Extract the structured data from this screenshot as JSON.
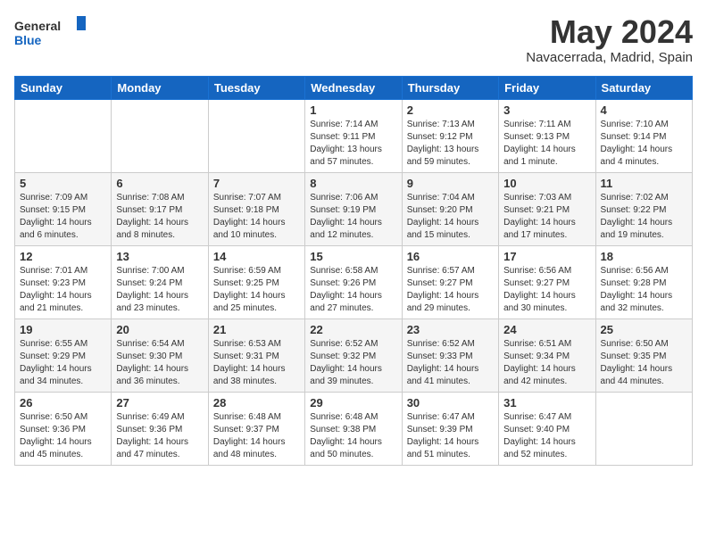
{
  "header": {
    "logo_general": "General",
    "logo_blue": "Blue",
    "month_title": "May 2024",
    "location": "Navacerrada, Madrid, Spain"
  },
  "weekdays": [
    "Sunday",
    "Monday",
    "Tuesday",
    "Wednesday",
    "Thursday",
    "Friday",
    "Saturday"
  ],
  "weeks": [
    [
      {
        "day": "",
        "info": ""
      },
      {
        "day": "",
        "info": ""
      },
      {
        "day": "",
        "info": ""
      },
      {
        "day": "1",
        "info": "Sunrise: 7:14 AM\nSunset: 9:11 PM\nDaylight: 13 hours\nand 57 minutes."
      },
      {
        "day": "2",
        "info": "Sunrise: 7:13 AM\nSunset: 9:12 PM\nDaylight: 13 hours\nand 59 minutes."
      },
      {
        "day": "3",
        "info": "Sunrise: 7:11 AM\nSunset: 9:13 PM\nDaylight: 14 hours\nand 1 minute."
      },
      {
        "day": "4",
        "info": "Sunrise: 7:10 AM\nSunset: 9:14 PM\nDaylight: 14 hours\nand 4 minutes."
      }
    ],
    [
      {
        "day": "5",
        "info": "Sunrise: 7:09 AM\nSunset: 9:15 PM\nDaylight: 14 hours\nand 6 minutes."
      },
      {
        "day": "6",
        "info": "Sunrise: 7:08 AM\nSunset: 9:17 PM\nDaylight: 14 hours\nand 8 minutes."
      },
      {
        "day": "7",
        "info": "Sunrise: 7:07 AM\nSunset: 9:18 PM\nDaylight: 14 hours\nand 10 minutes."
      },
      {
        "day": "8",
        "info": "Sunrise: 7:06 AM\nSunset: 9:19 PM\nDaylight: 14 hours\nand 12 minutes."
      },
      {
        "day": "9",
        "info": "Sunrise: 7:04 AM\nSunset: 9:20 PM\nDaylight: 14 hours\nand 15 minutes."
      },
      {
        "day": "10",
        "info": "Sunrise: 7:03 AM\nSunset: 9:21 PM\nDaylight: 14 hours\nand 17 minutes."
      },
      {
        "day": "11",
        "info": "Sunrise: 7:02 AM\nSunset: 9:22 PM\nDaylight: 14 hours\nand 19 minutes."
      }
    ],
    [
      {
        "day": "12",
        "info": "Sunrise: 7:01 AM\nSunset: 9:23 PM\nDaylight: 14 hours\nand 21 minutes."
      },
      {
        "day": "13",
        "info": "Sunrise: 7:00 AM\nSunset: 9:24 PM\nDaylight: 14 hours\nand 23 minutes."
      },
      {
        "day": "14",
        "info": "Sunrise: 6:59 AM\nSunset: 9:25 PM\nDaylight: 14 hours\nand 25 minutes."
      },
      {
        "day": "15",
        "info": "Sunrise: 6:58 AM\nSunset: 9:26 PM\nDaylight: 14 hours\nand 27 minutes."
      },
      {
        "day": "16",
        "info": "Sunrise: 6:57 AM\nSunset: 9:27 PM\nDaylight: 14 hours\nand 29 minutes."
      },
      {
        "day": "17",
        "info": "Sunrise: 6:56 AM\nSunset: 9:27 PM\nDaylight: 14 hours\nand 30 minutes."
      },
      {
        "day": "18",
        "info": "Sunrise: 6:56 AM\nSunset: 9:28 PM\nDaylight: 14 hours\nand 32 minutes."
      }
    ],
    [
      {
        "day": "19",
        "info": "Sunrise: 6:55 AM\nSunset: 9:29 PM\nDaylight: 14 hours\nand 34 minutes."
      },
      {
        "day": "20",
        "info": "Sunrise: 6:54 AM\nSunset: 9:30 PM\nDaylight: 14 hours\nand 36 minutes."
      },
      {
        "day": "21",
        "info": "Sunrise: 6:53 AM\nSunset: 9:31 PM\nDaylight: 14 hours\nand 38 minutes."
      },
      {
        "day": "22",
        "info": "Sunrise: 6:52 AM\nSunset: 9:32 PM\nDaylight: 14 hours\nand 39 minutes."
      },
      {
        "day": "23",
        "info": "Sunrise: 6:52 AM\nSunset: 9:33 PM\nDaylight: 14 hours\nand 41 minutes."
      },
      {
        "day": "24",
        "info": "Sunrise: 6:51 AM\nSunset: 9:34 PM\nDaylight: 14 hours\nand 42 minutes."
      },
      {
        "day": "25",
        "info": "Sunrise: 6:50 AM\nSunset: 9:35 PM\nDaylight: 14 hours\nand 44 minutes."
      }
    ],
    [
      {
        "day": "26",
        "info": "Sunrise: 6:50 AM\nSunset: 9:36 PM\nDaylight: 14 hours\nand 45 minutes."
      },
      {
        "day": "27",
        "info": "Sunrise: 6:49 AM\nSunset: 9:36 PM\nDaylight: 14 hours\nand 47 minutes."
      },
      {
        "day": "28",
        "info": "Sunrise: 6:48 AM\nSunset: 9:37 PM\nDaylight: 14 hours\nand 48 minutes."
      },
      {
        "day": "29",
        "info": "Sunrise: 6:48 AM\nSunset: 9:38 PM\nDaylight: 14 hours\nand 50 minutes."
      },
      {
        "day": "30",
        "info": "Sunrise: 6:47 AM\nSunset: 9:39 PM\nDaylight: 14 hours\nand 51 minutes."
      },
      {
        "day": "31",
        "info": "Sunrise: 6:47 AM\nSunset: 9:40 PM\nDaylight: 14 hours\nand 52 minutes."
      },
      {
        "day": "",
        "info": ""
      }
    ]
  ]
}
